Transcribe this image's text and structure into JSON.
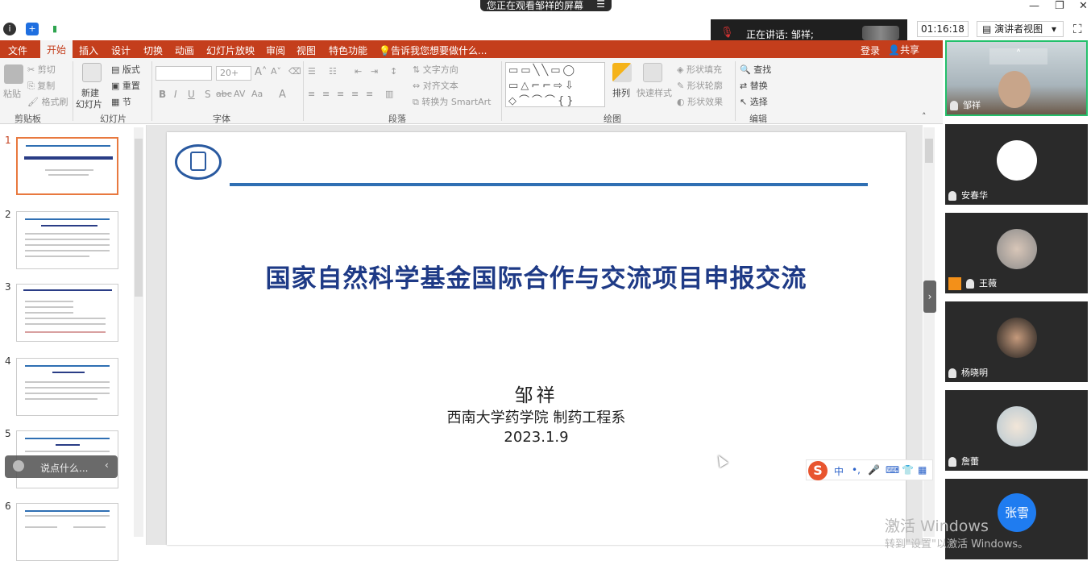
{
  "topbar": {
    "share_label": "您正在观看邹祥的屏幕",
    "menu_glyph": "☰",
    "min_glyph": "—",
    "max_glyph": "❐",
    "close_glyph": "✕"
  },
  "meeting": {
    "speaking_label": "正在讲话: 邹祥;",
    "timer": "01:16:18",
    "presenter_view": "演讲者视图",
    "fullscreen_glyph": "⛶"
  },
  "ribbon": {
    "tabs": [
      "文件",
      "开始",
      "插入",
      "设计",
      "切换",
      "动画",
      "幻灯片放映",
      "审阅",
      "视图",
      "特色功能"
    ],
    "tell_me": "告诉我您想要做什么...",
    "login": "登录",
    "share": "共享",
    "clipboard": {
      "paste": "粘贴",
      "cut": "剪切",
      "copy": "复制",
      "format_painter": "格式刷",
      "group": "剪贴板"
    },
    "slides": {
      "new_slide": "新建",
      "new_slide2": "幻灯片",
      "layout": "版式",
      "reset": "重置",
      "section": "节",
      "group": "幻灯片"
    },
    "font": {
      "size_value": "20+",
      "group": "字体"
    },
    "paragraph": {
      "text_direction": "文字方向",
      "align_text": "对齐文本",
      "smartart": "转换为 SmartArt",
      "group": "段落"
    },
    "drawing": {
      "arrange": "排列",
      "quick_styles": "快速样式",
      "shape_fill": "形状填充",
      "shape_outline": "形状轮廓",
      "shape_effects": "形状效果",
      "group": "绘图"
    },
    "editing": {
      "find": "查找",
      "replace": "替换",
      "select": "选择",
      "group": "编辑"
    }
  },
  "thumbnails": [
    "1",
    "2",
    "3",
    "4",
    "5",
    "6"
  ],
  "chat": {
    "placeholder": "说点什么..."
  },
  "slide": {
    "title": "国家自然科学基金国际合作与交流项目申报交流",
    "author": "邹祥",
    "affiliation": "西南大学药学院 制药工程系",
    "date": "2023.1.9"
  },
  "ime": {
    "keys": [
      "中",
      "•,",
      "🎤",
      "⌨",
      "👕",
      "▦"
    ]
  },
  "watermark": {
    "line1": "激活 Windows",
    "line2": "转到\"设置\"以激活 Windows。"
  },
  "participants": [
    {
      "name": "邹祥"
    },
    {
      "name": "安春华"
    },
    {
      "name": "王薇"
    },
    {
      "name": "杨晓明"
    },
    {
      "name": "詹蕾"
    },
    {
      "name": "张雪"
    }
  ],
  "colors": {
    "ribbon_accent": "#c43e1c",
    "slide_title": "#1e3a86",
    "slide_bar": "#2f6fb3",
    "active_speaker": "#24c06b"
  }
}
